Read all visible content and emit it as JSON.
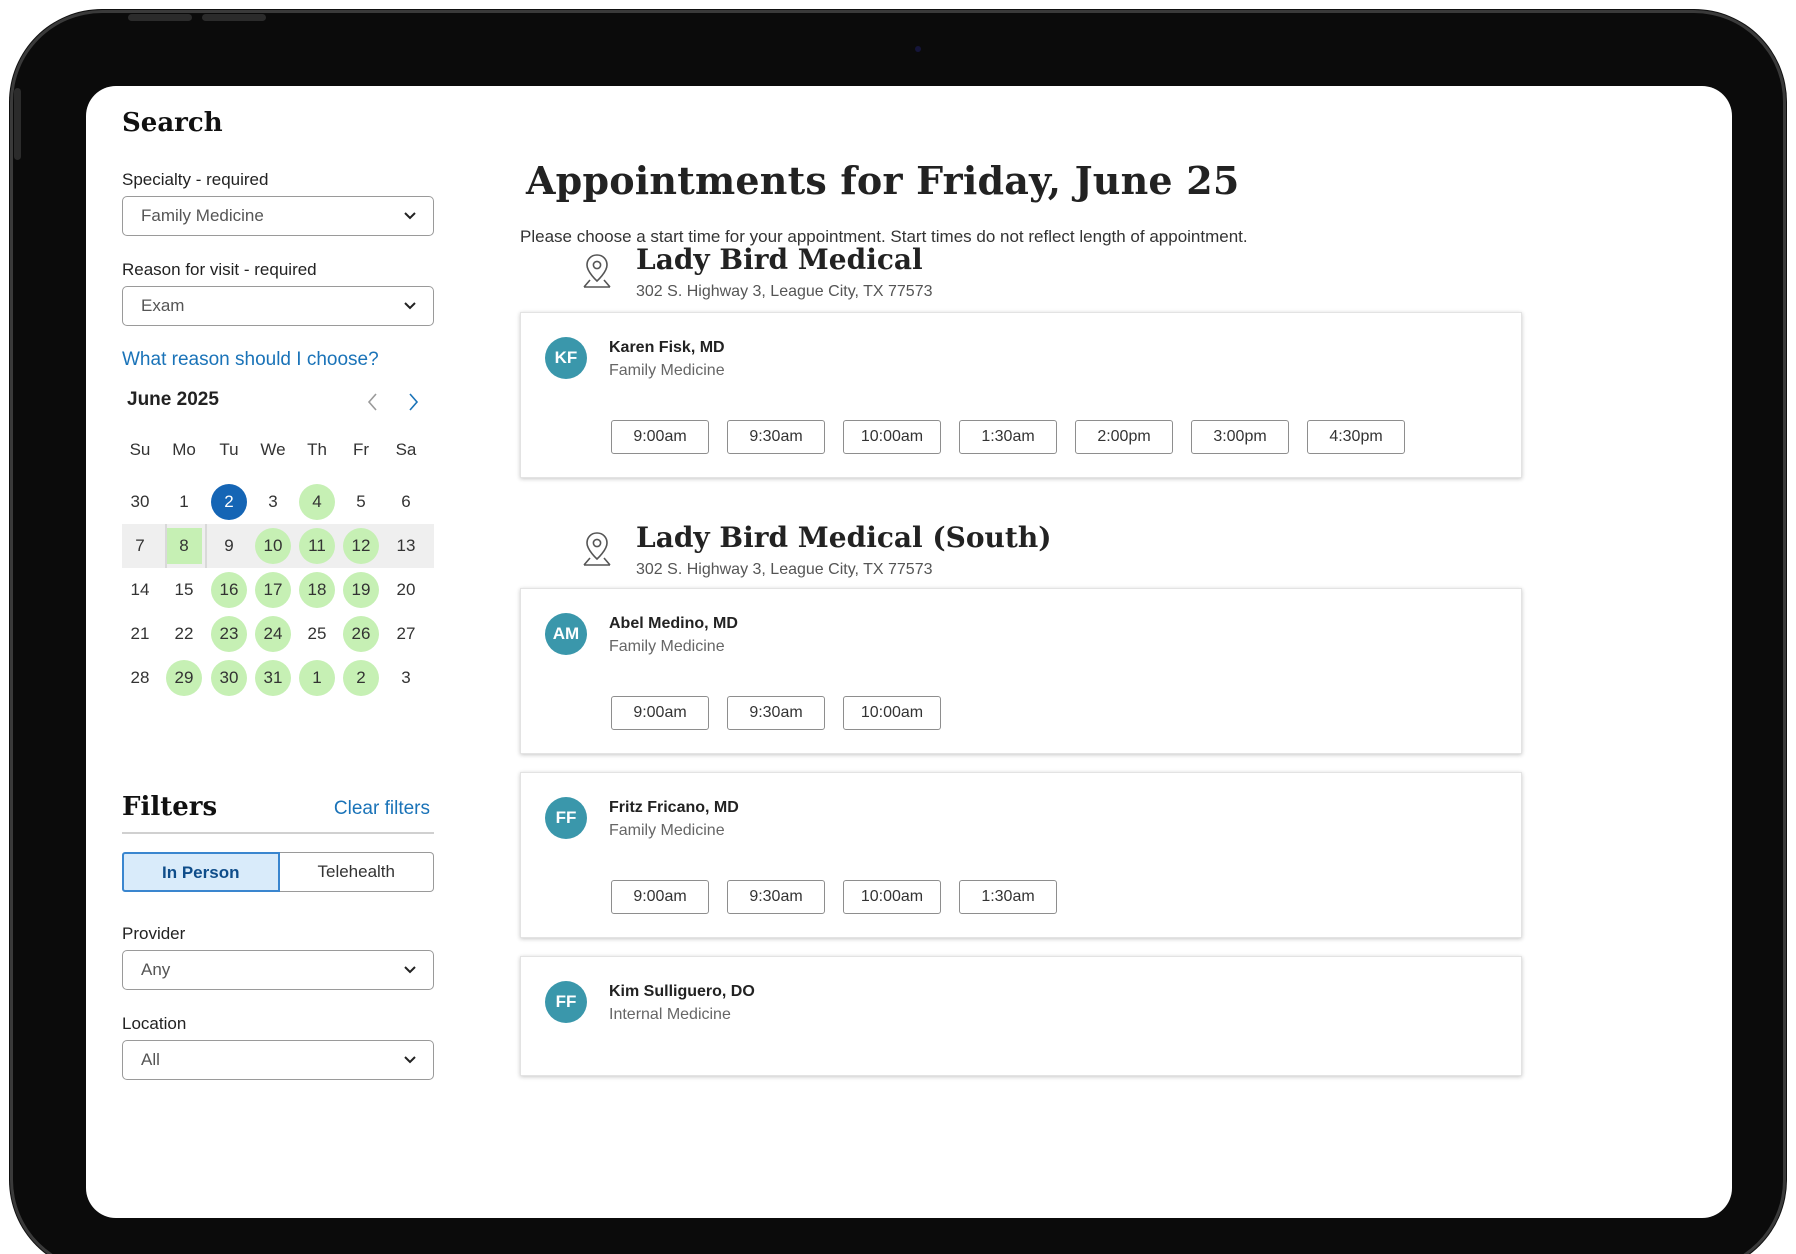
{
  "search": {
    "title": "Search",
    "specialty": {
      "label": "Specialty - required",
      "value": "Family Medicine"
    },
    "reason": {
      "label": "Reason for visit  - required",
      "value": "Exam"
    },
    "help_link": "What reason should I choose?"
  },
  "calendar": {
    "month_label": "June 2025",
    "days_of_week": [
      "Su",
      "Mo",
      "Tu",
      "We",
      "Th",
      "Fr",
      "Sa"
    ],
    "weeks": [
      [
        {
          "d": "30",
          "s": "none"
        },
        {
          "d": "1",
          "s": "none"
        },
        {
          "d": "2",
          "s": "selected"
        },
        {
          "d": "3",
          "s": "none"
        },
        {
          "d": "4",
          "s": "available"
        },
        {
          "d": "5",
          "s": "none"
        },
        {
          "d": "6",
          "s": "none"
        }
      ],
      [
        {
          "d": "7",
          "s": "none"
        },
        {
          "d": "8",
          "s": "today"
        },
        {
          "d": "9",
          "s": "none"
        },
        {
          "d": "10",
          "s": "available"
        },
        {
          "d": "11",
          "s": "available"
        },
        {
          "d": "12",
          "s": "available"
        },
        {
          "d": "13",
          "s": "none"
        }
      ],
      [
        {
          "d": "14",
          "s": "none"
        },
        {
          "d": "15",
          "s": "none"
        },
        {
          "d": "16",
          "s": "available"
        },
        {
          "d": "17",
          "s": "available"
        },
        {
          "d": "18",
          "s": "available"
        },
        {
          "d": "19",
          "s": "available"
        },
        {
          "d": "20",
          "s": "none"
        }
      ],
      [
        {
          "d": "21",
          "s": "none"
        },
        {
          "d": "22",
          "s": "none"
        },
        {
          "d": "23",
          "s": "available"
        },
        {
          "d": "24",
          "s": "available"
        },
        {
          "d": "25",
          "s": "none"
        },
        {
          "d": "26",
          "s": "available"
        },
        {
          "d": "27",
          "s": "none"
        }
      ],
      [
        {
          "d": "28",
          "s": "none"
        },
        {
          "d": "29",
          "s": "available"
        },
        {
          "d": "30",
          "s": "available"
        },
        {
          "d": "31",
          "s": "available"
        },
        {
          "d": "1",
          "s": "available"
        },
        {
          "d": "2",
          "s": "available"
        },
        {
          "d": "3",
          "s": "none"
        }
      ]
    ]
  },
  "filters": {
    "title": "Filters",
    "clear_label": "Clear filters",
    "visit_types": [
      "In Person",
      "Telehealth"
    ],
    "active_visit_type": "In Person",
    "provider": {
      "label": "Provider",
      "value": "Any"
    },
    "location": {
      "label": "Location",
      "value": "All"
    }
  },
  "main": {
    "title": "Appointments for Friday, June 25",
    "intro": "Please choose a start time for your appointment. Start times do not reflect length of appointment."
  },
  "locations": [
    {
      "name": "Lady Bird Medical",
      "address": "302 S. Highway 3, League City, TX 77573",
      "providers": [
        {
          "initials": "KF",
          "name": "Karen Fisk, MD",
          "specialty": "Family Medicine",
          "slots": [
            "9:00am",
            "9:30am",
            "10:00am",
            "1:30am",
            "2:00pm",
            "3:00pm",
            "4:30pm"
          ]
        }
      ]
    },
    {
      "name": "Lady Bird Medical (South)",
      "address": "302 S. Highway 3, League City, TX 77573",
      "providers": [
        {
          "initials": "AM",
          "name": "Abel Medino, MD",
          "specialty": "Family Medicine",
          "slots": [
            "9:00am",
            "9:30am",
            "10:00am"
          ]
        },
        {
          "initials": "FF",
          "name": "Fritz Fricano, MD",
          "specialty": "Family Medicine",
          "slots": [
            "9:00am",
            "9:30am",
            "10:00am",
            "1:30am"
          ]
        },
        {
          "initials": "FF",
          "name": "Kim Sulliguero, DO",
          "specialty": "Internal Medicine",
          "slots": []
        }
      ]
    }
  ],
  "colors": {
    "accent_blue": "#1a73b8",
    "selected_day": "#1565b5",
    "available_day": "#c6f0b4",
    "avatar": "#3a97ab",
    "active_segment_bg": "#d9ebfa"
  },
  "icons": {
    "select_chevron": "chevron-down-icon",
    "prev_month": "chevron-left-icon",
    "next_month": "chevron-right-icon",
    "location_pin": "map-pin-icon"
  }
}
